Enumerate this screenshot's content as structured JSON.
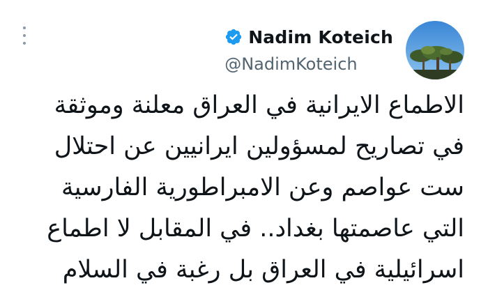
{
  "header": {
    "display_name": "Nadim Koteich",
    "handle": "@NadimKoteich",
    "verified_icon": "verified-badge-icon",
    "more_icon": "vertical-ellipsis-icon",
    "accent_color": "#1d9bf0"
  },
  "tweet": {
    "lines": [
      "الاطماع الايرانية في العراق معلنة وموثقة",
      "في تصاريح لمسؤولين ايرانيين عن احتلال",
      "ست عواصم وعن الامبراطورية الفارسية",
      "التي عاصمتها بغداد.. في المقابل لا اطماع",
      "اسرائيلية في العراق بل رغبة في السلام"
    ]
  }
}
